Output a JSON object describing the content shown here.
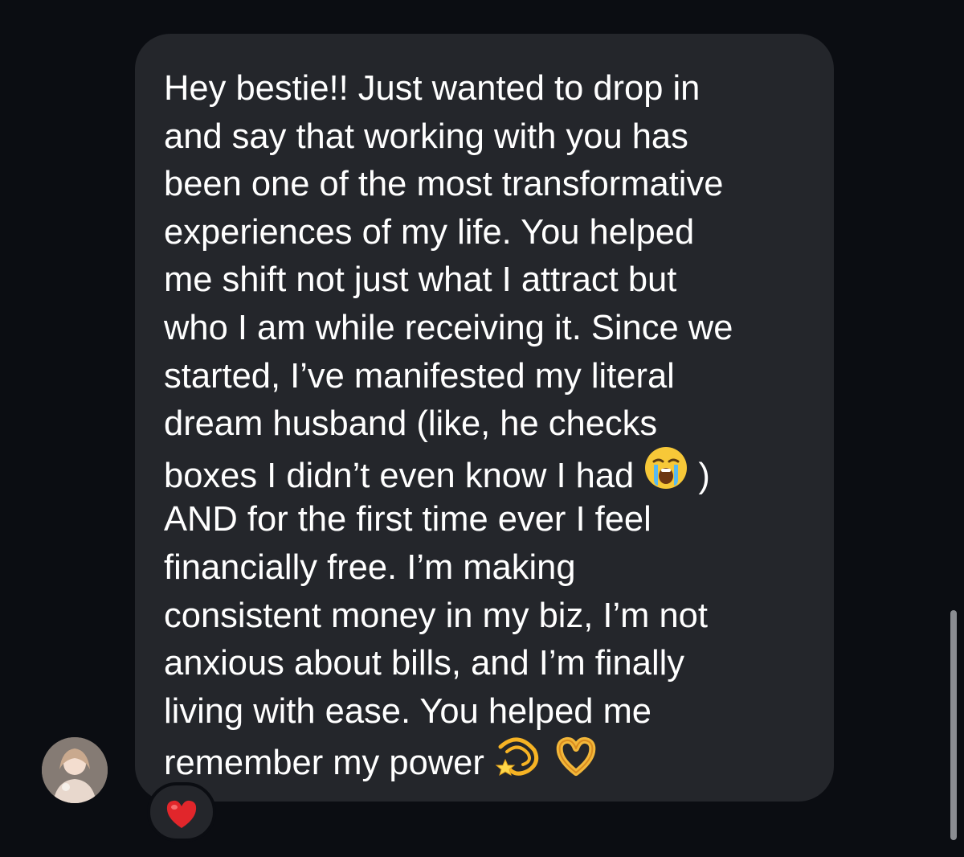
{
  "message": {
    "lines": [
      "Hey bestie!! Just wanted to drop in",
      "and say that working with you has",
      "been one of the most transformative",
      "experiences of my life. You helped",
      "me shift not just what I attract but",
      "who I am while receiving it. Since we",
      "started, I’ve manifested my literal",
      "dream husband (like, he checks",
      "boxes I didn’t even know I had",
      "AND for the first time ever I feel",
      "financially free. I’m making",
      "consistent money in my biz, I’m not",
      "anxious about bills, and I’m finally",
      "living with ease. You helped me",
      "remember my power"
    ],
    "line_9_suffix": ")",
    "emojis": [
      "crying-face-icon",
      "dizzy-icon",
      "heart-hands-icon"
    ]
  },
  "reaction": {
    "icon": "red-heart-icon",
    "color": "#e1262b"
  },
  "avatar": {
    "icon": "user-avatar"
  }
}
